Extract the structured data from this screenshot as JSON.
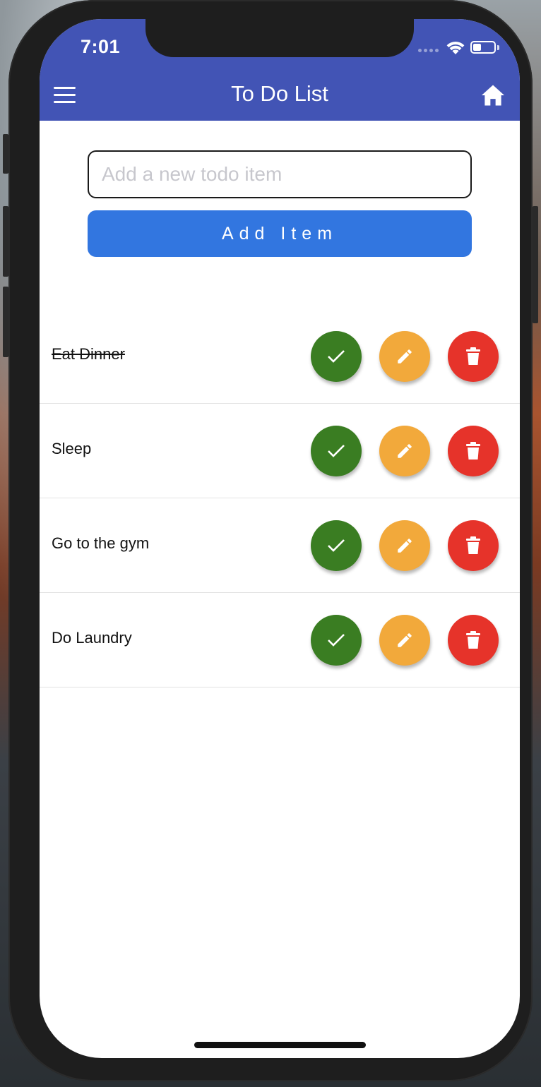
{
  "status_bar": {
    "time": "7:01",
    "battery_level": 0.4
  },
  "app_bar": {
    "title": "To Do List",
    "menu_icon": "hamburger-menu-icon",
    "home_icon": "home-icon"
  },
  "input": {
    "value": "",
    "placeholder": "Add a new todo item"
  },
  "add_button": {
    "label": "Add Item"
  },
  "colors": {
    "app_bar": "#4254b5",
    "add_button": "#3276e0",
    "complete": "#3a7d22",
    "edit": "#f2a93b",
    "delete": "#e6332a"
  },
  "todos": [
    {
      "text": "Eat Dinner",
      "completed": true
    },
    {
      "text": "Sleep",
      "completed": false
    },
    {
      "text": "Go to the gym",
      "completed": false
    },
    {
      "text": "Do Laundry",
      "completed": false
    }
  ],
  "row_action_icons": [
    "check-icon",
    "pencil-icon",
    "trash-icon"
  ]
}
